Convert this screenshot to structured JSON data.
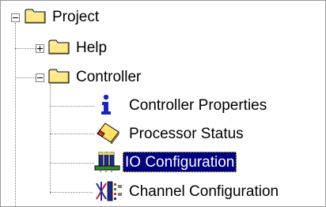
{
  "tree": {
    "root": {
      "label": "Project",
      "expanded": true,
      "icon": "folder-icon"
    },
    "help": {
      "label": "Help",
      "expanded": false,
      "icon": "folder-icon"
    },
    "controller": {
      "label": "Controller",
      "expanded": true,
      "icon": "folder-icon",
      "children": [
        {
          "label": "Controller Properties",
          "icon": "info-icon"
        },
        {
          "label": "Processor Status",
          "icon": "processor-status-icon"
        },
        {
          "label": "IO Configuration",
          "icon": "io-configuration-icon",
          "selected": true
        },
        {
          "label": "Channel Configuration",
          "icon": "channel-configuration-icon"
        }
      ]
    }
  },
  "colors": {
    "selection_bg": "#000080",
    "selection_text": "#ffffff",
    "folder_fill": "#ffe88a",
    "info_blue": "#1a24b8"
  }
}
